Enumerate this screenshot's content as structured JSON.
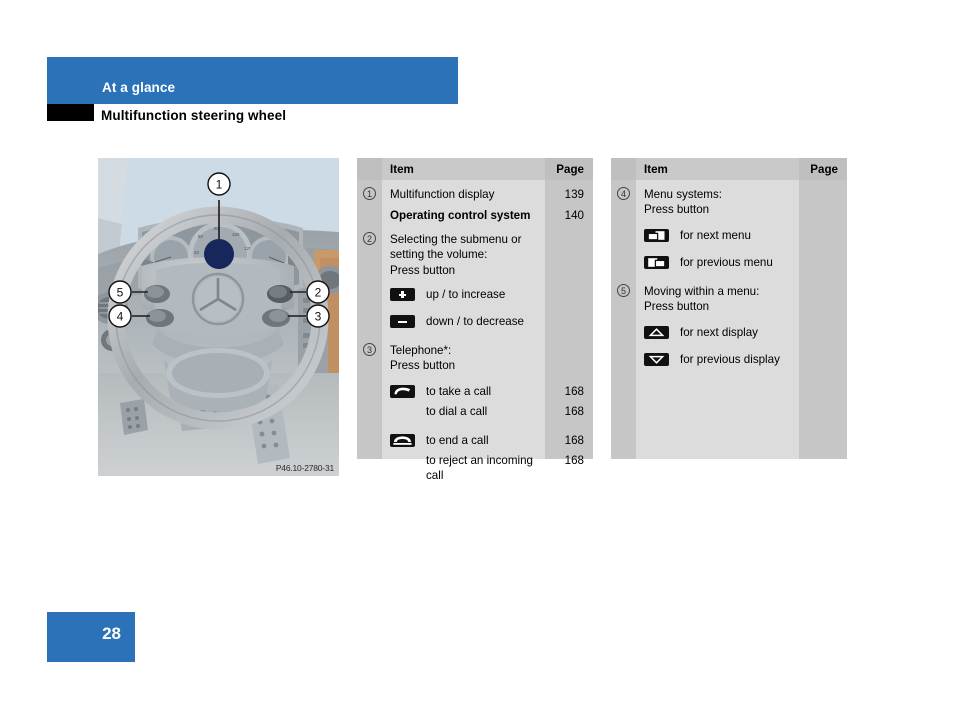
{
  "header": {
    "chapter_title": "At a glance",
    "section_title": "Multifunction steering wheel"
  },
  "figure": {
    "caption": "P46.10-2780-31",
    "alt": "Mercedes-Benz multifunction steering wheel and dashboard",
    "callouts": [
      "1",
      "2",
      "3",
      "4",
      "5"
    ]
  },
  "tables": {
    "left": {
      "header": {
        "item": "Item",
        "page": "Page"
      },
      "rows": [
        {
          "marker": "1",
          "text": "Multifunction display",
          "page": "139",
          "bold": false
        },
        {
          "marker": "",
          "text": "Operating control system",
          "page": "140",
          "bold": true
        },
        {
          "marker": "2",
          "text": "Selecting the submenu or\nsetting the volume:\nPress button",
          "page": "",
          "bold": false
        },
        {
          "icon": "plus-button-icon",
          "label": "up / to increase",
          "page": ""
        },
        {
          "icon": "minus-button-icon",
          "label": "down / to decrease",
          "page": ""
        },
        {
          "marker": "3",
          "text": "Telephone*:\nPress button",
          "page": "",
          "bold": false
        },
        {
          "icon": "phone-offhook-icon",
          "label": "to take a call",
          "page": "168"
        },
        {
          "icon": "",
          "label": "to dial a call",
          "page": "168"
        },
        {
          "icon": "phone-onhook-icon",
          "label": "to end a call",
          "page": "168"
        },
        {
          "icon": "",
          "label": "to reject an incoming\ncall",
          "page": "168"
        }
      ]
    },
    "right": {
      "header": {
        "item": "Item",
        "page": "Page"
      },
      "rows": [
        {
          "marker": "4",
          "text": "Menu systems:\nPress button",
          "page": "",
          "bold": false
        },
        {
          "icon": "next-menu-icon",
          "label": "for next menu",
          "page": ""
        },
        {
          "icon": "previous-menu-icon",
          "label": "for previous menu",
          "page": ""
        },
        {
          "marker": "5",
          "text": "Moving within a menu:\nPress button",
          "page": "",
          "bold": false
        },
        {
          "icon": "arrow-up-icon",
          "label": "for next display",
          "page": ""
        },
        {
          "icon": "arrow-down-icon",
          "label": "for previous display",
          "page": ""
        }
      ]
    }
  },
  "footer": {
    "page_number": "28"
  },
  "colors": {
    "brand_blue": "#2b72b8",
    "table_item_bg": "#dcdcdc",
    "table_side_bg": "#c6c6c6",
    "table_header_bg": "#c9c9c9"
  }
}
